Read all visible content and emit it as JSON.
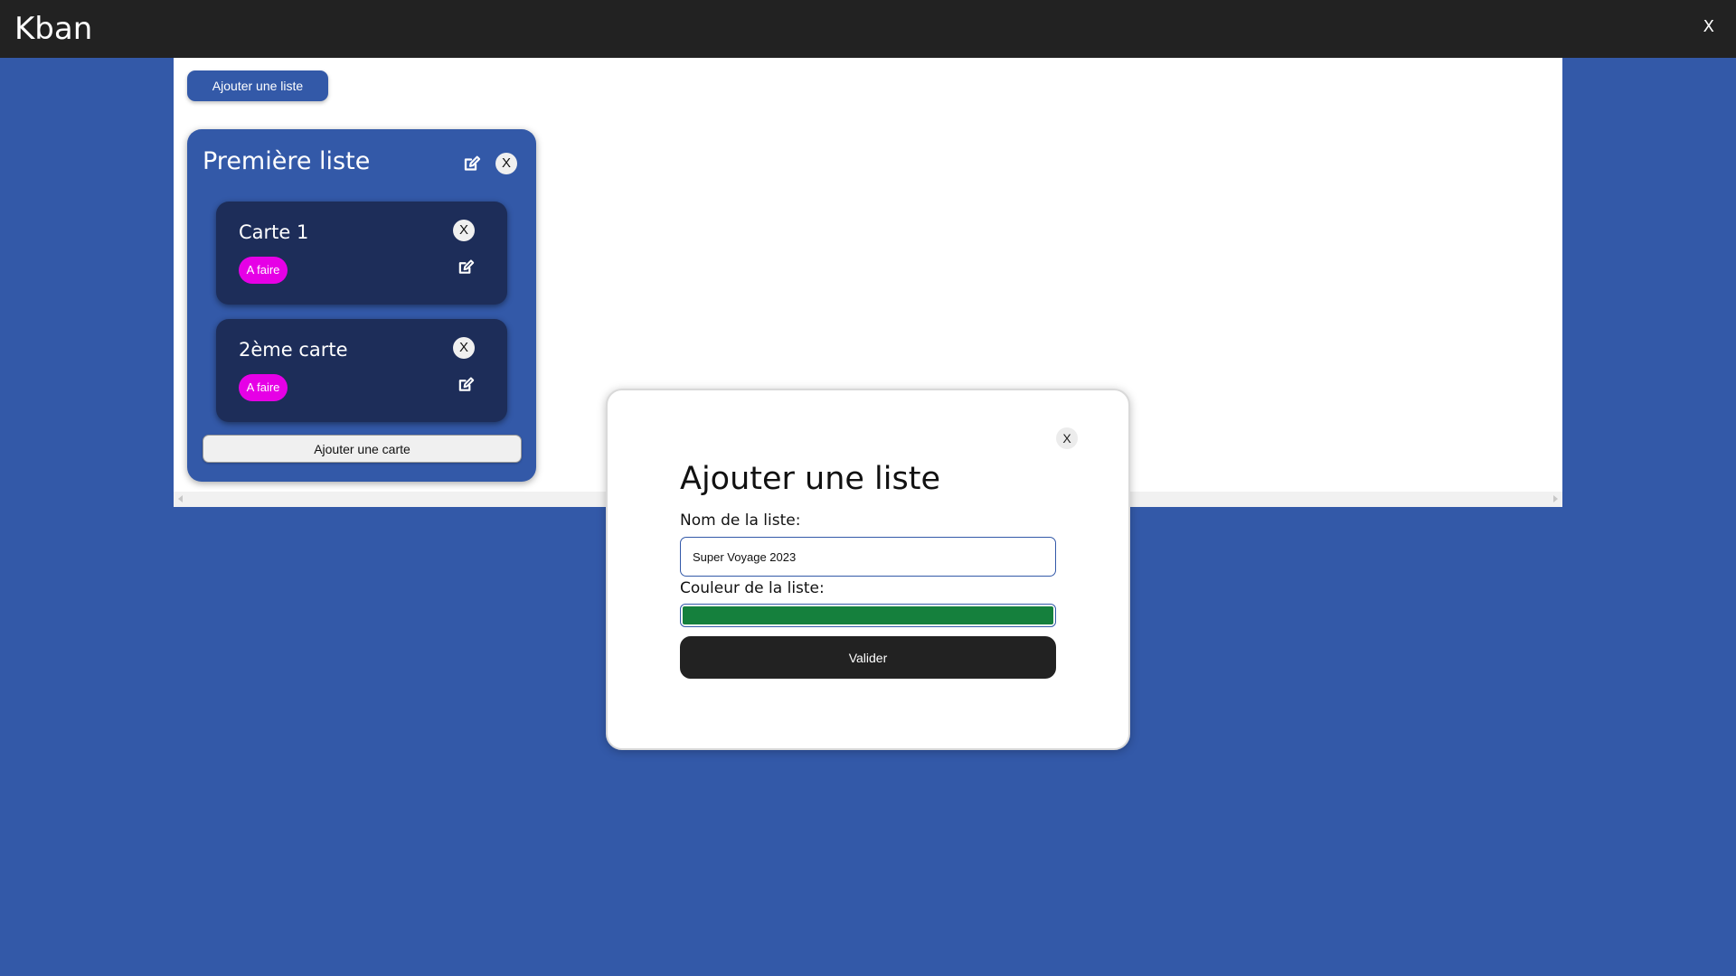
{
  "app": {
    "title": "Kban",
    "close_label": "X"
  },
  "board": {
    "add_list_label": "Ajouter une liste",
    "lists": [
      {
        "title": "Première liste",
        "close_label": "X",
        "edit_icon": "edit-icon",
        "cards": [
          {
            "title": "Carte 1",
            "close_label": "X",
            "badge": "A faire",
            "badge_color": "#e600e6",
            "edit_icon": "edit-icon"
          },
          {
            "title": "2ème carte",
            "close_label": "X",
            "badge": "A faire",
            "badge_color": "#e600e6",
            "edit_icon": "edit-icon"
          }
        ],
        "add_card_label": "Ajouter une carte"
      }
    ]
  },
  "modal": {
    "close_label": "X",
    "title": "Ajouter une liste",
    "name_label": "Nom de la liste:",
    "name_value": "Super Voyage 2023",
    "color_label": "Couleur de la liste:",
    "color_value": "#15803d",
    "submit_label": "Valider"
  },
  "colors": {
    "background": "#3359a8",
    "topbar": "#222222",
    "card": "#1d2d59",
    "badge": "#e600e6",
    "button_dark": "#222222"
  }
}
